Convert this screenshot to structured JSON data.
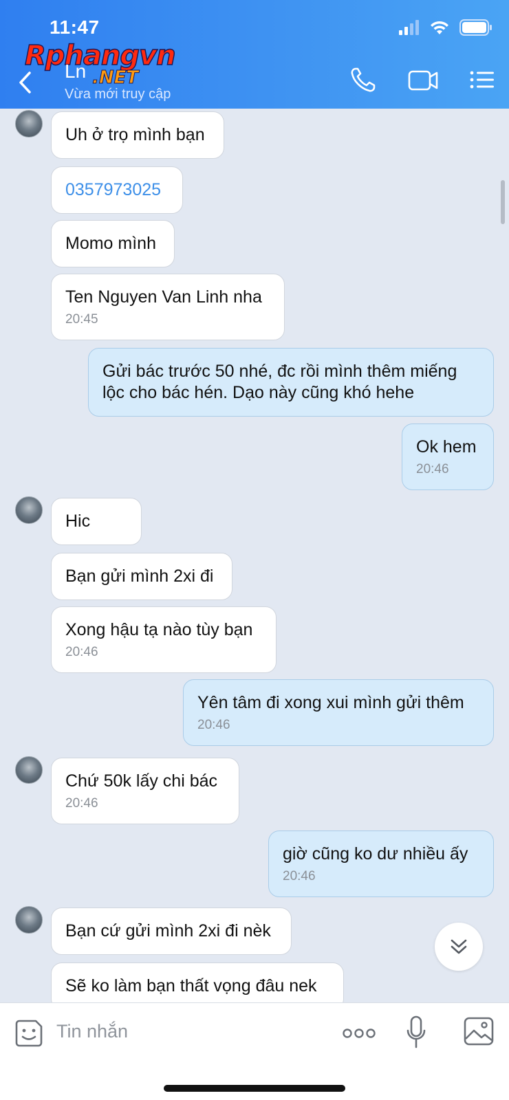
{
  "status_bar": {
    "time": "11:47"
  },
  "watermark": {
    "main": "Rphangvn",
    "sub": ".NET"
  },
  "header": {
    "contact_name": "Ln",
    "contact_status": "Vừa mới truy cập"
  },
  "icons": {
    "back": "chevron-left-icon",
    "call": "phone-icon",
    "video": "video-camera-icon",
    "menu": "list-menu-icon",
    "emoji": "sticker-face-icon",
    "more": "more-dots-icon",
    "mic": "microphone-icon",
    "image": "image-icon",
    "scroll": "chevron-double-down-icon"
  },
  "messages": [
    {
      "dir": "in",
      "text": "Uh ở trọ mình bạn",
      "time": ""
    },
    {
      "dir": "in",
      "text": "0357973025",
      "time": ""
    },
    {
      "dir": "in",
      "text": "Momo mình",
      "time": ""
    },
    {
      "dir": "in",
      "text": "Ten Nguyen Van Linh nha",
      "time": "20:45"
    },
    {
      "dir": "out",
      "text": "Gửi bác trước 50 nhé, đc rồi mình thêm miếng lộc cho bác hén. Dạo này cũng khó hehe",
      "time": ""
    },
    {
      "dir": "out",
      "text": "Ok hem",
      "time": "20:46"
    },
    {
      "dir": "in",
      "text": "Hic",
      "time": ""
    },
    {
      "dir": "in",
      "text": "Bạn gửi mình 2xi đi",
      "time": ""
    },
    {
      "dir": "in",
      "text": "Xong hậu tạ nào tùy bạn",
      "time": "20:46"
    },
    {
      "dir": "out",
      "text": "Yên tâm đi xong xui mình gửi thêm",
      "time": "20:46"
    },
    {
      "dir": "in",
      "text": "Chứ 50k lấy chi bác",
      "time": "20:46"
    },
    {
      "dir": "out",
      "text": "giờ cũng ko dư nhiều ấy",
      "time": "20:46"
    },
    {
      "dir": "in",
      "text": "Bạn cứ gửi mình 2xi đi nèk",
      "time": ""
    },
    {
      "dir": "in",
      "text": "Sẽ ko làm bạn thất vọng đâu nek",
      "time": ""
    }
  ],
  "composer": {
    "placeholder": "Tin nhắn"
  },
  "colors": {
    "header_start": "#2f7ff0",
    "header_end": "#4aa4f4",
    "incoming": "#ffffff",
    "outgoing": "#d6ebfb",
    "link": "#3d8fe8"
  }
}
